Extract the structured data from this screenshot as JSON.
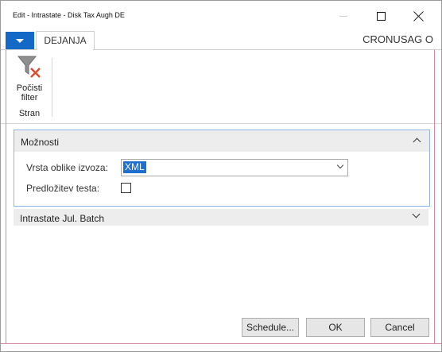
{
  "window": {
    "title": "Edit - Intrastate - Disk Tax Augh DE"
  },
  "ribbon": {
    "tab_label": "DEJANJA",
    "company": "CRONUSAG O",
    "clear_filter_label_line1": "Počisti",
    "clear_filter_label_line2": "filter",
    "group_label": "Stran"
  },
  "options": {
    "title": "Možnosti",
    "export_format_label": "Vrsta oblike izvoza:",
    "export_format_value": "XML",
    "test_submission_label": "Predložitev testa:",
    "test_submission_checked": false
  },
  "batch": {
    "title": "Intrastate Jul. Batch"
  },
  "footer": {
    "schedule_label": "Schedule...",
    "ok_label": "OK",
    "cancel_label": "Cancel"
  },
  "colors": {
    "accent": "#1469c7",
    "selection": "#1f6fd1",
    "section_bg": "#ededed"
  }
}
